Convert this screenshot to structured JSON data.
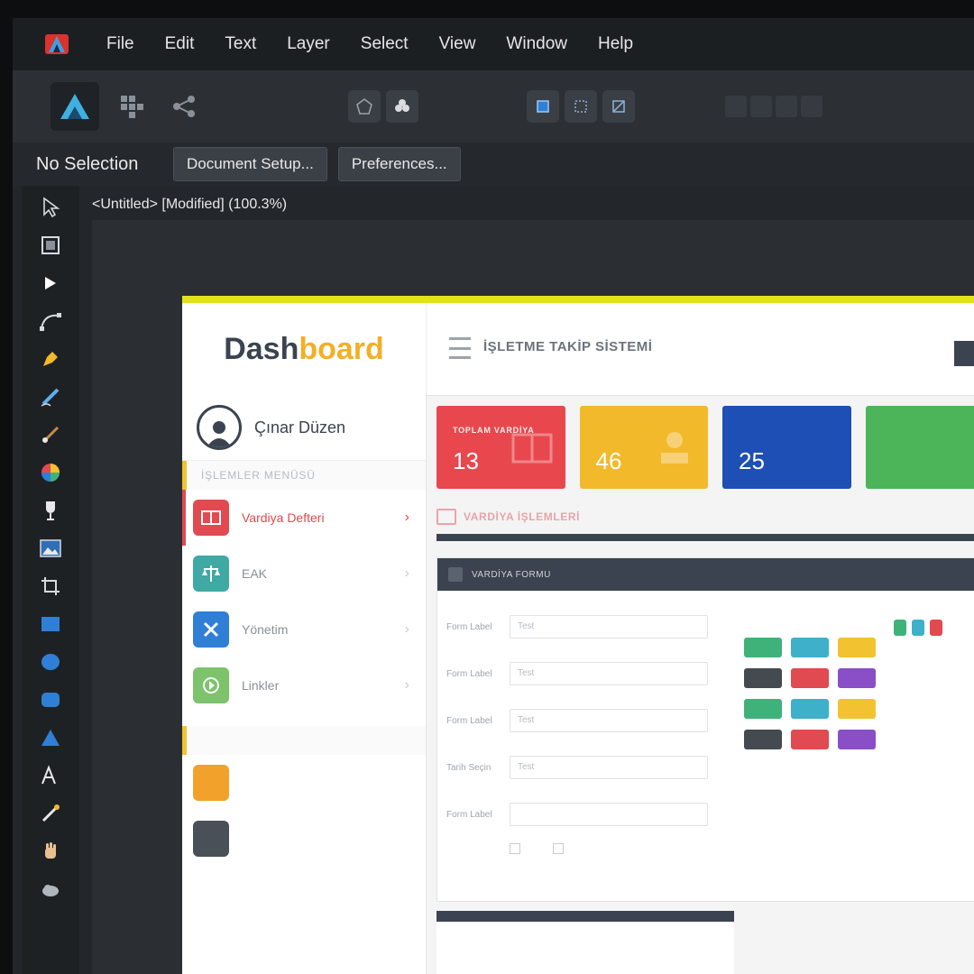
{
  "menubar": {
    "items": [
      "File",
      "Edit",
      "Text",
      "Layer",
      "Select",
      "View",
      "Window",
      "Help"
    ]
  },
  "contextbar": {
    "selection": "No Selection",
    "document_setup": "Document Setup...",
    "preferences": "Preferences..."
  },
  "document": {
    "title": "<Untitled> [Modified] (100.3%)"
  },
  "dashboard": {
    "brand_dash": "Dash",
    "brand_board": "board",
    "app_title": "İŞLETME TAKİP SİSTEMİ",
    "user_name": "Çınar Düzen",
    "menu_title": "İŞLEMLER MENÜSÜ",
    "menu_items": [
      {
        "label": "Vardiya Defteri",
        "color": "#e04a50"
      },
      {
        "label": "EAK",
        "color": "#3fa9a4"
      },
      {
        "label": "Yönetim",
        "color": "#2f7fd6"
      },
      {
        "label": "Linkler",
        "color": "#7cc36b"
      }
    ],
    "stats": [
      {
        "label": "TOPLAM VARDİYA",
        "value": "13",
        "color": "#e8474e"
      },
      {
        "label": "",
        "value": "46",
        "color": "#f2b92b"
      },
      {
        "label": "",
        "value": "25",
        "color": "#1e4fb5"
      },
      {
        "label": "",
        "value": "",
        "color": "#4cb55a"
      }
    ],
    "section_title": "VARDİYA İŞLEMLERİ",
    "panel_title": "VARDİYA FORMU",
    "form_labels": [
      "Form Label",
      "Form Label",
      "Form Label",
      "Tarih Seçin",
      "Form Label"
    ],
    "form_placeholder": "Test",
    "swatch_colors": [
      "#3fb27a",
      "#3fb0c9",
      "#f2c230",
      "#444a50",
      "#e04a50",
      "#8a4fc7",
      "#3fb27a",
      "#3fb0c9",
      "#f2c230",
      "#444a50",
      "#e04a50",
      "#8a4fc7"
    ]
  }
}
